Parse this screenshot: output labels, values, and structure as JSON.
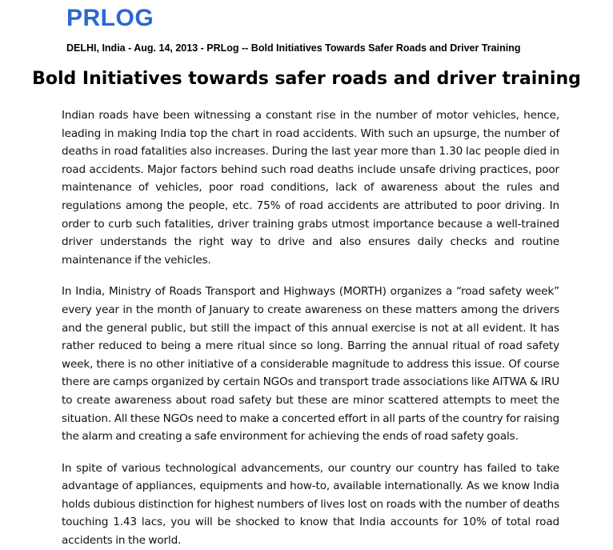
{
  "brand": {
    "logo_text": "PRLOG"
  },
  "article": {
    "dateline": "DELHI, India - Aug. 14, 2013 - PRLog -- Bold Initiatives Towards Safer Roads and Driver Training",
    "headline": "Bold Initiatives towards safer roads and driver training",
    "paragraphs": [
      "Indian roads have been witnessing a constant rise in the number of motor vehicles, hence, leading in making India top the chart in road accidents. With such an upsurge, the number of deaths in road fatalities also increases. During the last year more than 1.30 lac people died in road accidents. Major factors behind such road deaths include unsafe driving practices, poor maintenance of vehicles, poor road conditions, lack of awareness about the rules and regulations among the people, etc. 75% of road accidents are attributed to poor driving. In order to curb such fatalities, driver training grabs utmost importance because a well-trained driver understands the right way to drive and also ensures daily checks and routine maintenance if the vehicles.",
      "In India, Ministry of Roads Transport and Highways (MORTH) organizes a “road safety week” every year in the month of January to create awareness on these matters among the drivers and the general public, but still the impact of this annual exercise is not at all evident. It has rather reduced to being a mere ritual since so long. Barring the annual ritual of road safety week, there is no other initiative of a considerable magnitude to address this issue. Of course there are camps organized by certain NGOs and transport trade associations like AITWA & IRU to create awareness about road safety but these are minor scattered attempts to meet the situation. All these NGOs need to make a concerted effort in all parts of the country for raising the alarm and creating a safe environment for achieving the ends of road safety goals.",
      "In spite of various technological advancements, our country our country has failed to take advantage of appliances, equipments and how-to, available internationally. As we know India holds dubious distinction for highest numbers of lives lost on roads with the number of deaths touching 1.43 lacs, you will be shocked to know that India accounts for 10% of total road accidents in the world."
    ]
  },
  "colors": {
    "brand": "#2a68d2",
    "text": "#111111",
    "background": "#ffffff"
  }
}
